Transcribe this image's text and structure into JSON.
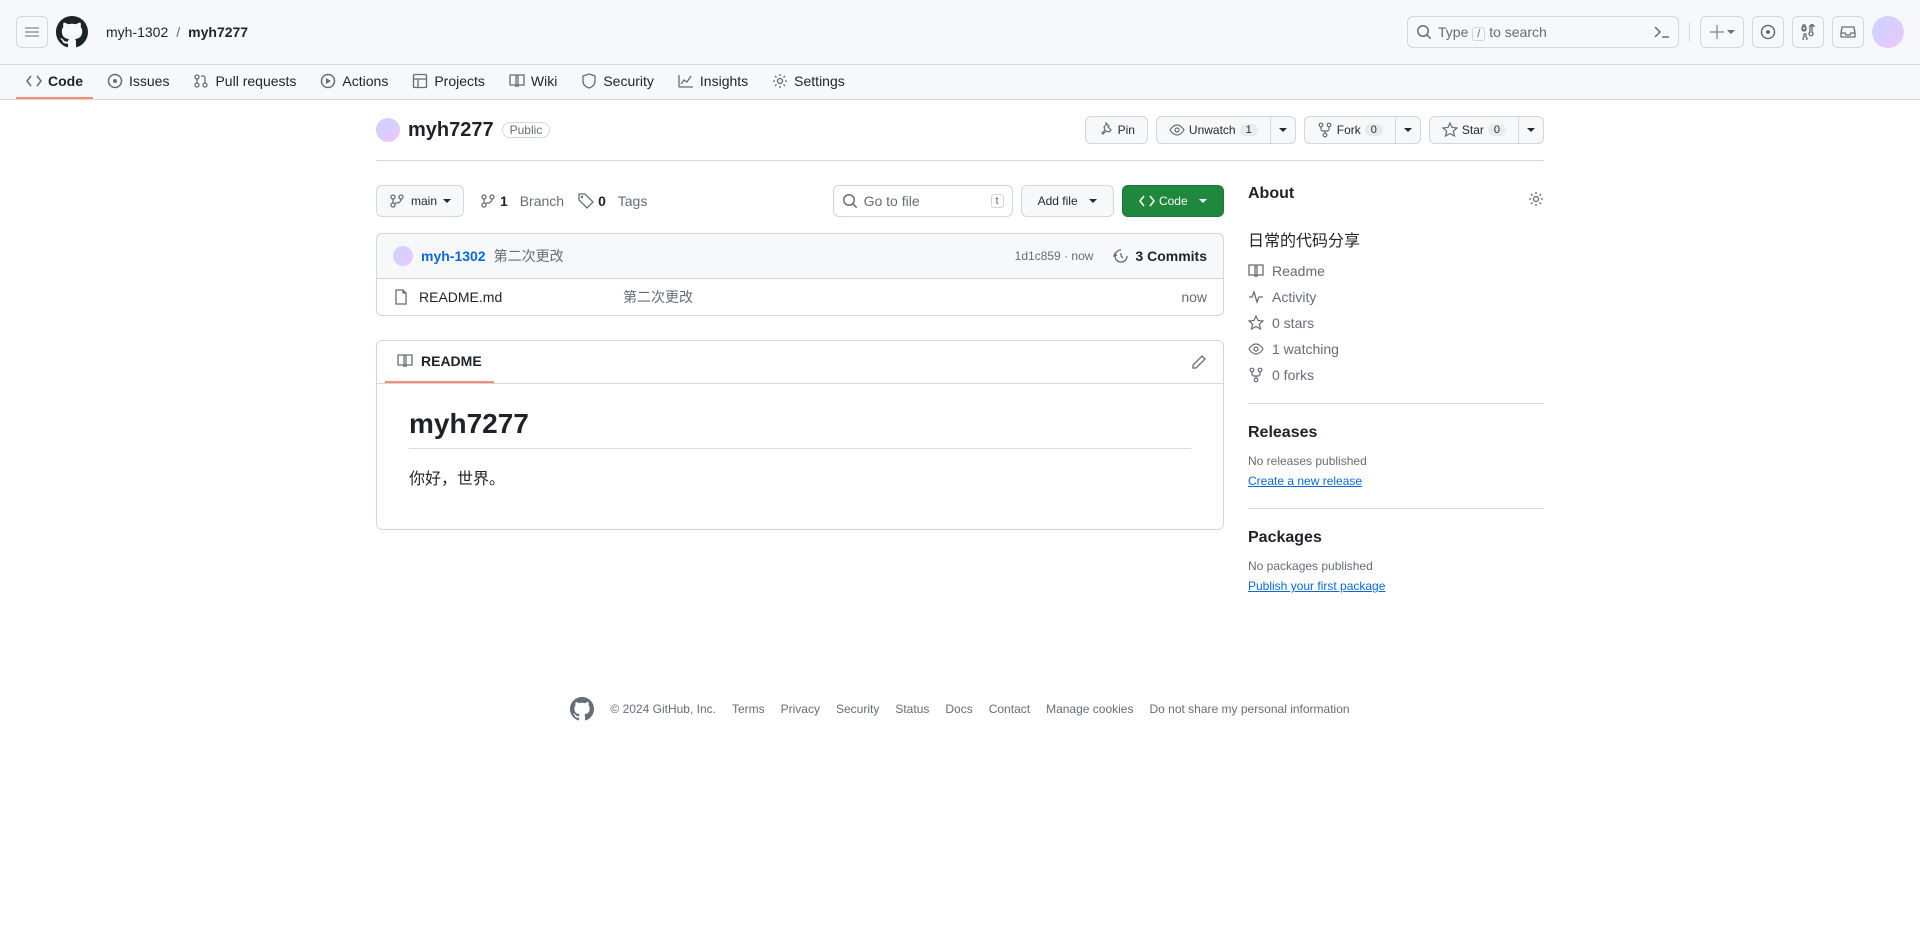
{
  "header": {
    "owner": "myh-1302",
    "repo": "myh7277",
    "search_prefix": "Type ",
    "search_suffix": " to search",
    "search_kbd": "/"
  },
  "nav": {
    "code": "Code",
    "issues": "Issues",
    "pull_requests": "Pull requests",
    "actions": "Actions",
    "projects": "Projects",
    "wiki": "Wiki",
    "security": "Security",
    "insights": "Insights",
    "settings": "Settings"
  },
  "repo_head": {
    "title": "myh7277",
    "visibility": "Public",
    "pin": "Pin",
    "unwatch": "Unwatch",
    "unwatch_count": "1",
    "fork": "Fork",
    "fork_count": "0",
    "star": "Star",
    "star_count": "0"
  },
  "file_nav": {
    "branch": "main",
    "branch_count": "1",
    "branch_label": "Branch",
    "tag_count": "0",
    "tag_label": "Tags",
    "go_to_file": "Go to file",
    "go_to_file_kbd": "t",
    "add_file": "Add file",
    "code": "Code"
  },
  "commit_bar": {
    "author": "myh-1302",
    "message": "第二次更改",
    "sha": "1d1c859",
    "time": "now",
    "commits_count": "3",
    "commits_label": "Commits"
  },
  "files": [
    {
      "name": "README.md",
      "message": "第二次更改",
      "time": "now"
    }
  ],
  "readme": {
    "tab_label": "README",
    "title": "myh7277",
    "body": "你好，世界。"
  },
  "sidebar": {
    "about_title": "About",
    "about_desc": "日常的代码分享",
    "readme": "Readme",
    "activity": "Activity",
    "stars": "0 stars",
    "watching": "1 watching",
    "forks": "0 forks",
    "releases_title": "Releases",
    "no_releases": "No releases published",
    "create_release": "Create a new release",
    "packages_title": "Packages",
    "no_packages": "No packages published",
    "publish_package": "Publish your first package"
  },
  "footer": {
    "copyright": "© 2024 GitHub, Inc.",
    "links": [
      "Terms",
      "Privacy",
      "Security",
      "Status",
      "Docs",
      "Contact",
      "Manage cookies",
      "Do not share my personal information"
    ]
  }
}
